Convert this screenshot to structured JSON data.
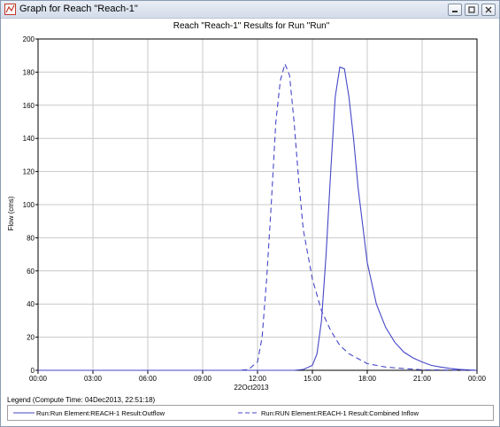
{
  "window": {
    "title": "Graph for Reach \"Reach-1\"",
    "controls": [
      "minimize",
      "maximize",
      "close"
    ]
  },
  "chart_data": {
    "type": "line",
    "title": "Reach \"Reach-1\" Results for Run \"Run\"",
    "xlabel": "22Oct2013",
    "ylabel": "Flow (cms)",
    "xlim": [
      "00:00",
      "00:00"
    ],
    "ylim": [
      0,
      200
    ],
    "yticks": [
      "0",
      "20",
      "40",
      "60",
      "80",
      "100",
      "120",
      "140",
      "160",
      "180",
      "200"
    ],
    "xticks": [
      "00:00",
      "03:00",
      "06:00",
      "09:00",
      "12:00",
      "15:00",
      "18:00",
      "21:00",
      "00:00"
    ],
    "grid": true,
    "series": [
      {
        "name": "Run:Run Element:REACH-1 Result:Outflow",
        "style": "solid",
        "color": "#4646c8",
        "x_hours": [
          0,
          14,
          14.5,
          15,
          15.25,
          15.5,
          15.75,
          16,
          16.25,
          16.5,
          16.75,
          17,
          17.25,
          17.5,
          18,
          18.5,
          19,
          19.5,
          20,
          20.5,
          21,
          21.5,
          22,
          22.5,
          23,
          24
        ],
        "values": [
          0,
          0,
          0.5,
          3,
          10,
          30,
          70,
          120,
          165,
          183,
          182,
          165,
          140,
          110,
          65,
          40,
          26,
          17,
          11,
          7.5,
          5,
          3,
          2,
          1.2,
          0.6,
          0
        ]
      },
      {
        "name": "Run:RUN Element:REACH-1 Result:Combined Inflow",
        "style": "dashed",
        "color": "#4646c8",
        "x_hours": [
          0,
          11,
          11.5,
          12,
          12.25,
          12.5,
          12.75,
          13,
          13.25,
          13.5,
          13.75,
          14,
          14.25,
          14.5,
          15,
          15.5,
          16,
          16.5,
          17,
          17.5,
          18,
          19,
          20,
          21,
          24
        ],
        "values": [
          0,
          0,
          0.5,
          5,
          20,
          55,
          100,
          150,
          175,
          185,
          178,
          150,
          115,
          85,
          55,
          36,
          24,
          15,
          10,
          7,
          4,
          2,
          1,
          0.3,
          0
        ]
      }
    ]
  },
  "legend": {
    "label": "Legend (Compute Time: 04Dec2013, 22:51:18)",
    "entries": [
      {
        "text": "Run:Run Element:REACH-1 Result:Outflow",
        "style": "solid"
      },
      {
        "text": "Run:RUN Element:REACH-1 Result:Combined Inflow",
        "style": "dashed"
      }
    ]
  }
}
